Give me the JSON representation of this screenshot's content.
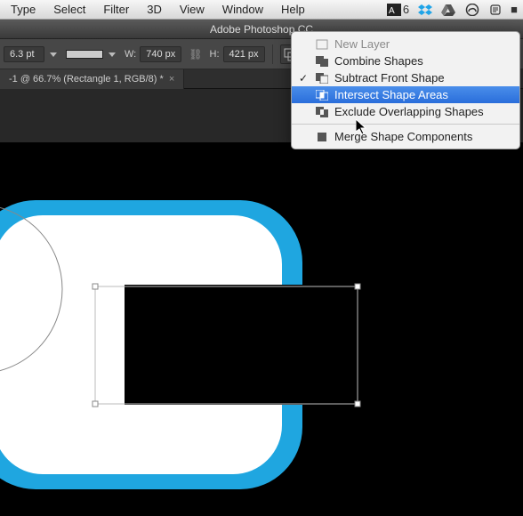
{
  "menubar": {
    "items": [
      "Type",
      "Select",
      "Filter",
      "3D",
      "View",
      "Window",
      "Help"
    ],
    "right_a6": "6"
  },
  "app": {
    "title": "Adobe Photoshop CC"
  },
  "options": {
    "stroke_width": "6.3 pt",
    "w_label": "W:",
    "w_value": "740 px",
    "h_label": "H:",
    "h_value": "421 px"
  },
  "tab": {
    "label": "-1 @ 66.7% (Rectangle 1, RGB/8) *",
    "close": "×"
  },
  "dropdown": {
    "items": [
      {
        "label": "New Layer",
        "disabled": true,
        "checked": false
      },
      {
        "label": "Combine Shapes",
        "disabled": false,
        "checked": false
      },
      {
        "label": "Subtract Front Shape",
        "disabled": false,
        "checked": true
      },
      {
        "label": "Intersect Shape Areas",
        "disabled": false,
        "checked": false,
        "selected": true
      },
      {
        "label": "Exclude Overlapping Shapes",
        "disabled": false,
        "checked": false
      }
    ],
    "merge": {
      "label": "Merge Shape Components"
    }
  }
}
